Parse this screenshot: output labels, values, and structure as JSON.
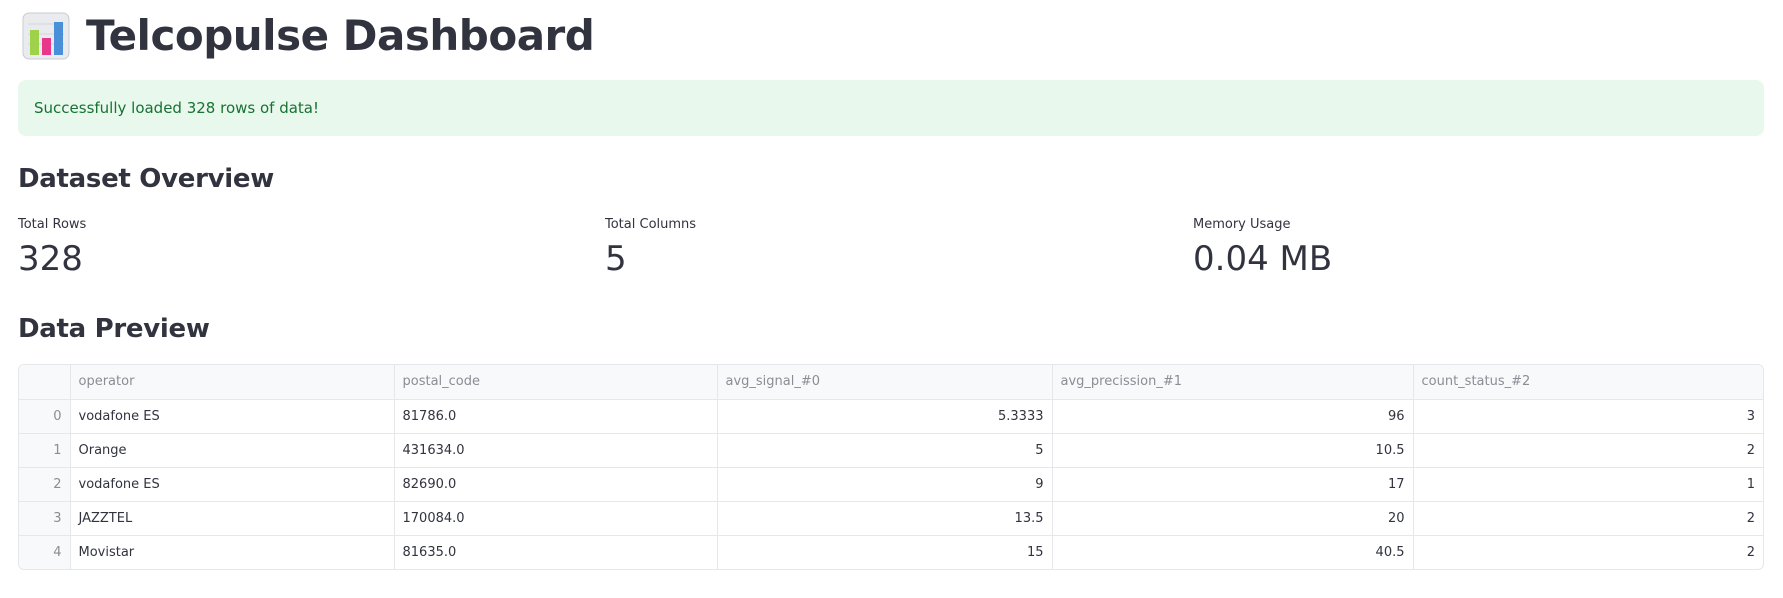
{
  "header": {
    "title": "Telcopulse Dashboard",
    "icon": "bar-chart-icon"
  },
  "alert": {
    "message": "Successfully loaded 328 rows of data!",
    "color": "#177233",
    "background": "#e8f8ec"
  },
  "overview": {
    "heading": "Dataset Overview",
    "metrics": [
      {
        "label": "Total Rows",
        "value": "328"
      },
      {
        "label": "Total Columns",
        "value": "5"
      },
      {
        "label": "Memory Usage",
        "value": "0.04 MB"
      }
    ]
  },
  "preview": {
    "heading": "Data Preview",
    "columns": [
      "",
      "operator",
      "postal_code",
      "avg_signal_#0",
      "avg_precission_#1",
      "count_status_#2"
    ],
    "rows": [
      [
        "0",
        "vodafone ES",
        "81786.0",
        "5.3333",
        "96",
        "3"
      ],
      [
        "1",
        "Orange",
        "431634.0",
        "5",
        "10.5",
        "2"
      ],
      [
        "2",
        "vodafone ES",
        "82690.0",
        "9",
        "17",
        "1"
      ],
      [
        "3",
        "JAZZTEL",
        "170084.0",
        "13.5",
        "20",
        "2"
      ],
      [
        "4",
        "Movistar",
        "81635.0",
        "15",
        "40.5",
        "2"
      ]
    ]
  }
}
